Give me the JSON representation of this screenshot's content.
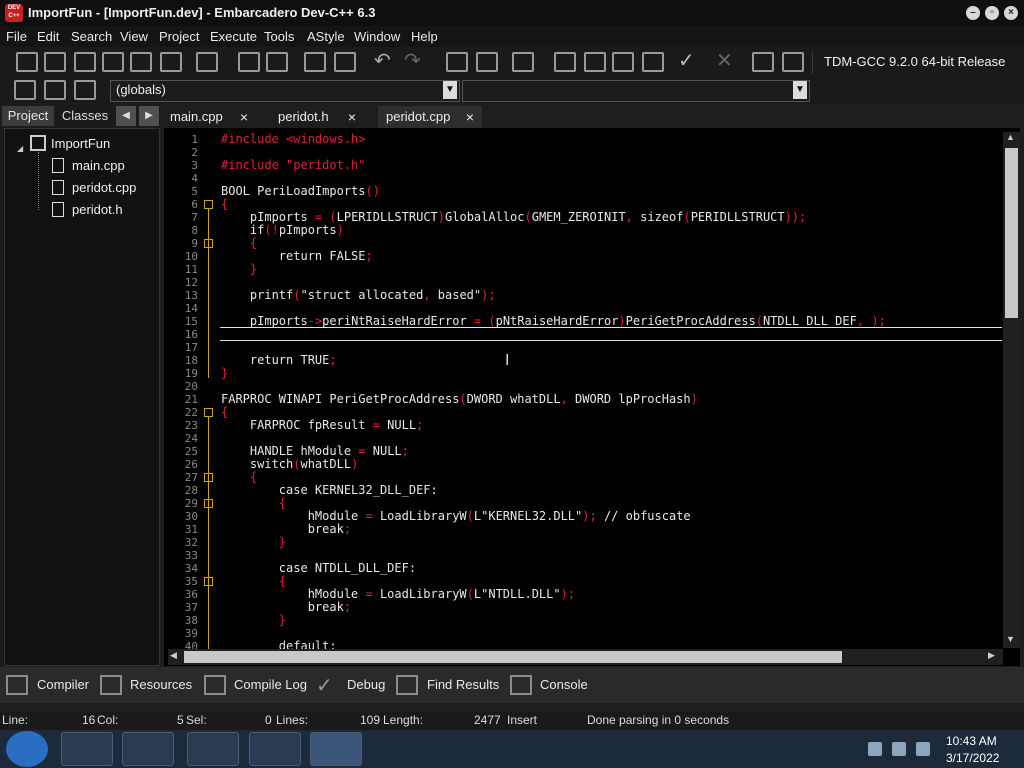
{
  "window": {
    "title": "ImportFun - [ImportFun.dev] - Embarcadero Dev-C++ 6.3",
    "app_icon_text": "DEV C++"
  },
  "menu": [
    "File",
    "Edit",
    "Search",
    "View",
    "Project",
    "Execute",
    "Tools",
    "AStyle",
    "Window",
    "Help"
  ],
  "toolbar": {
    "compiler": "TDM-GCC 9.2.0 64-bit Release",
    "scope_select": "(globals)",
    "function_select": ""
  },
  "left_panel": {
    "tabs": [
      "Project",
      "Classes"
    ],
    "tree": {
      "project": "ImportFun",
      "files": [
        "main.cpp",
        "peridot.cpp",
        "peridot.h"
      ]
    }
  },
  "editor": {
    "tabs": [
      "main.cpp",
      "peridot.h",
      "peridot.cpp"
    ],
    "active_tab": "peridot.cpp",
    "lines": [
      {
        "n": "1",
        "text": "#include <windows.h>"
      },
      {
        "n": "2",
        "text": ""
      },
      {
        "n": "3",
        "text": "#include \"peridot.h\""
      },
      {
        "n": "4",
        "text": ""
      },
      {
        "n": "5",
        "text": "BOOL PeriLoadImports()"
      },
      {
        "n": "6",
        "text": "{"
      },
      {
        "n": "7",
        "text": "    pImports = (LPERIDLLSTRUCT)GlobalAlloc(GMEM_ZEROINIT, sizeof(PERIDLLSTRUCT));"
      },
      {
        "n": "8",
        "text": "    if(!pImports)"
      },
      {
        "n": "9",
        "text": "    {"
      },
      {
        "n": "10",
        "text": "        return FALSE;"
      },
      {
        "n": "11",
        "text": "    }"
      },
      {
        "n": "12",
        "text": ""
      },
      {
        "n": "13",
        "text": "    printf(\"struct allocated, based\");"
      },
      {
        "n": "14",
        "text": ""
      },
      {
        "n": "15",
        "text": "    pImports->periNtRaiseHardError = (pNtRaiseHardError)PeriGetProcAddress(NTDLL_DLL_DEF, );"
      },
      {
        "n": "16",
        "text": ""
      },
      {
        "n": "17",
        "text": ""
      },
      {
        "n": "18",
        "text": "    return TRUE;"
      },
      {
        "n": "19",
        "text": "}"
      },
      {
        "n": "20",
        "text": ""
      },
      {
        "n": "21",
        "text": "FARPROC WINAPI PeriGetProcAddress(DWORD whatDLL, DWORD lpProcHash)"
      },
      {
        "n": "22",
        "text": "{"
      },
      {
        "n": "23",
        "text": "    FARPROC fpResult = NULL;"
      },
      {
        "n": "24",
        "text": ""
      },
      {
        "n": "25",
        "text": "    HANDLE hModule = NULL;"
      },
      {
        "n": "26",
        "text": "    switch(whatDLL)"
      },
      {
        "n": "27",
        "text": "    {"
      },
      {
        "n": "28",
        "text": "        case KERNEL32_DLL_DEF:"
      },
      {
        "n": "29",
        "text": "        {"
      },
      {
        "n": "30",
        "text": "            hModule = LoadLibraryW(L\"KERNEL32.DLL\"); // obfuscate"
      },
      {
        "n": "31",
        "text": "            break;"
      },
      {
        "n": "32",
        "text": "        }"
      },
      {
        "n": "33",
        "text": ""
      },
      {
        "n": "34",
        "text": "        case NTDLL_DLL_DEF:"
      },
      {
        "n": "35",
        "text": "        {"
      },
      {
        "n": "36",
        "text": "            hModule = LoadLibraryW(L\"NTDLL.DLL\");"
      },
      {
        "n": "37",
        "text": "            break;"
      },
      {
        "n": "38",
        "text": "        }"
      },
      {
        "n": "39",
        "text": ""
      },
      {
        "n": "40",
        "text": "        default:"
      }
    ]
  },
  "bottom_tabs": [
    "Compiler",
    "Resources",
    "Compile Log",
    "Debug",
    "Find Results",
    "Console"
  ],
  "status": {
    "line_label": "Line:",
    "line_val": "16",
    "col_label": "Col:",
    "col_val": "5",
    "sel_label": "Sel:",
    "sel_val": "0",
    "lines_label": "Lines:",
    "lines_val": "109",
    "length_label": "Length:",
    "length_val": "2477",
    "mode": "Insert",
    "message": "Done parsing in 0 seconds"
  },
  "taskbar": {
    "apps": [
      "explorer",
      "media-player",
      "chrome",
      "notepad-plus",
      "devcpp"
    ],
    "time": "10:43 AM",
    "date": "3/17/2022"
  },
  "colors": {
    "keyword": "#e8e8e8",
    "string": "#e8e8e8",
    "punct": "#e0203a",
    "preproc": "#e0203a",
    "fold": "#d4a017"
  }
}
